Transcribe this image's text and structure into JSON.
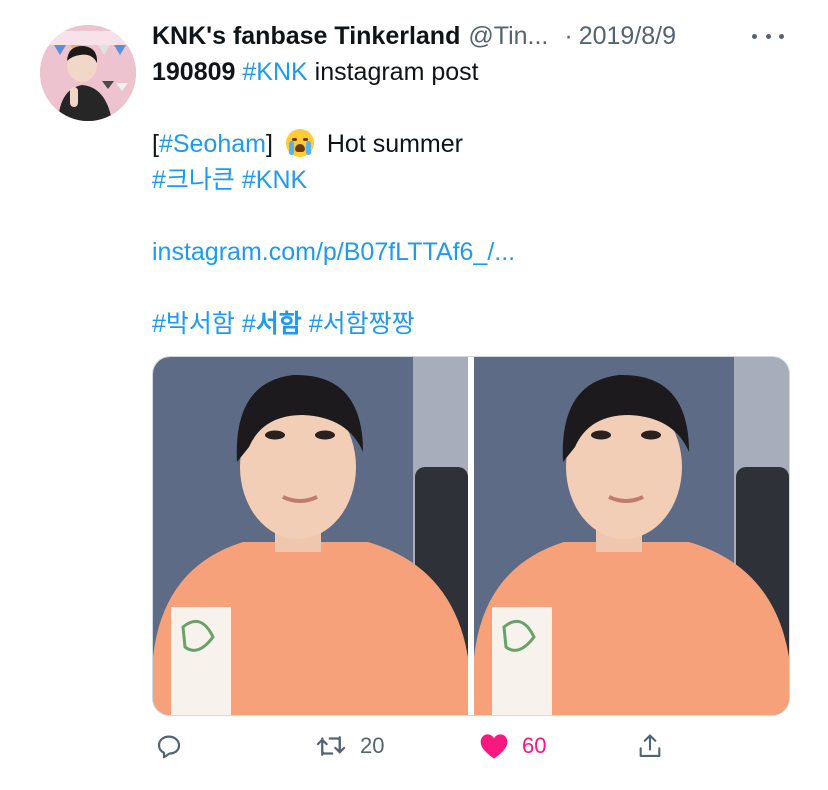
{
  "tweet": {
    "author": {
      "display_name": "KNK's fanbase Tinkerland",
      "handle": "@Tin...",
      "avatar_icon": "profile-photo"
    },
    "separator": "·",
    "date": "2019/8/9",
    "text": {
      "line1": {
        "date_code": "190809",
        "hashtag": "#KNK",
        "rest": " instagram post"
      },
      "line2": {
        "open_bracket": "[",
        "hashtag": "#Seoham",
        "close_bracket": "]",
        "emoji": "loudly-crying-face",
        "rest": "Hot summer"
      },
      "line3": {
        "hashtag1": "#크나큰",
        "space": " ",
        "hashtag2": "#KNK"
      },
      "link": "instagram.com/p/B07fLTTAf6_/...",
      "line5": {
        "hashtag1": "#박서함",
        "space1": " ",
        "hashtag2_prefix": "#",
        "hashtag2_bold": "서함",
        "space2": " ",
        "hashtag3": "#서함짱짱"
      }
    },
    "media": [
      {
        "name": "photo-1",
        "alt_icon": "selfie-photo"
      },
      {
        "name": "photo-2",
        "alt_icon": "selfie-photo"
      }
    ],
    "actions": {
      "reply": {
        "icon": "reply-icon"
      },
      "retweet": {
        "icon": "retweet-icon",
        "count": "20"
      },
      "like": {
        "icon": "heart-icon",
        "count": "60",
        "liked": true
      },
      "share": {
        "icon": "share-icon"
      }
    }
  },
  "colors": {
    "link": "#1d9bf0",
    "secondary_text": "#536471",
    "like": "#f91880",
    "border": "#cfd9de"
  }
}
